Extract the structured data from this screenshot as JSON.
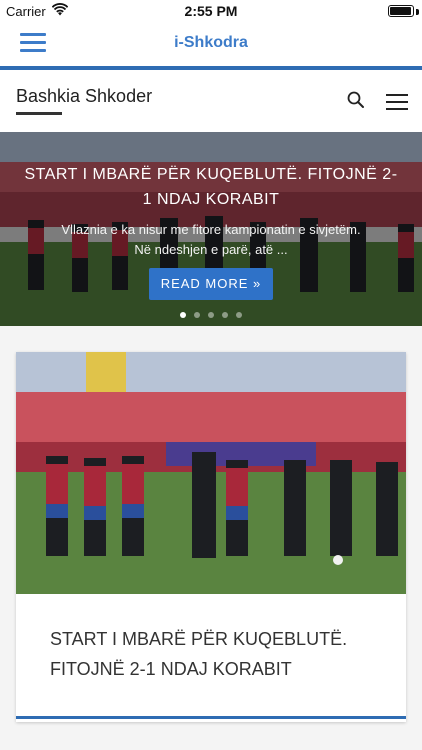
{
  "status_bar": {
    "carrier": "Carrier",
    "time": "2:55 PM",
    "battery_level": 0.95
  },
  "nav": {
    "title": "i-Shkodra",
    "menu_icon": "hamburger-menu-icon",
    "accent": "#3d7cc9"
  },
  "header": {
    "site_title": "Bashkia Shkoder",
    "search_icon": "search-icon",
    "menu_icon": "hamburger-menu-icon"
  },
  "slider": {
    "title": "START I MBARË PËR KUQEBLUTË. FITOJNË 2-1 NDAJ KORABIT",
    "excerpt_line1": "Vllaznia e ka nisur me fitore kampionatin e sivjetëm.",
    "excerpt_line2": "Në ndeshjen e parë, atë ...",
    "button_label": "READ MORE »",
    "button_color": "#2f72c8",
    "active_slide": 1,
    "total_slides": 5
  },
  "articles": [
    {
      "title": "START I MBARË PËR KUQEBLUTË. FITOJNË 2-1 NDAJ KORABIT"
    }
  ],
  "colors": {
    "brand_blue": "#2e6cb3",
    "text": "#333333"
  }
}
